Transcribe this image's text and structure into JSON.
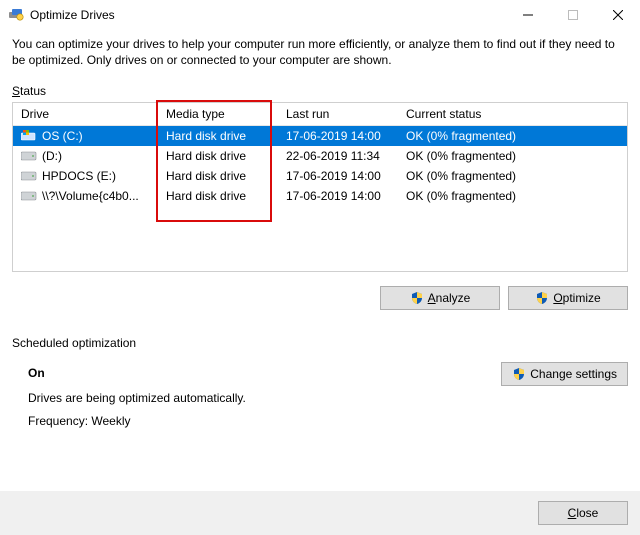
{
  "window": {
    "title": "Optimize Drives"
  },
  "description": "You can optimize your drives to help your computer run more efficiently, or analyze them to find out if they need to be optimized. Only drives on or connected to your computer are shown.",
  "labels": {
    "status_prefix": "S",
    "status_rest": "tatus"
  },
  "columns": {
    "drive": "Drive",
    "media": "Media type",
    "last": "Last run",
    "status": "Current status"
  },
  "drives": [
    {
      "name": "OS (C:)",
      "media": "Hard disk drive",
      "last": "17-06-2019 14:00",
      "status": "OK (0% fragmented)",
      "icon": "os",
      "selected": true
    },
    {
      "name": "(D:)",
      "media": "Hard disk drive",
      "last": "22-06-2019 11:34",
      "status": "OK (0% fragmented)",
      "icon": "hdd",
      "selected": false
    },
    {
      "name": "HPDOCS (E:)",
      "media": "Hard disk drive",
      "last": "17-06-2019 14:00",
      "status": "OK (0% fragmented)",
      "icon": "hdd",
      "selected": false
    },
    {
      "name": "\\\\?\\Volume{c4b0...",
      "media": "Hard disk drive",
      "last": "17-06-2019 14:00",
      "status": "OK (0% fragmented)",
      "icon": "hdd",
      "selected": false
    }
  ],
  "buttons": {
    "analyze_u": "A",
    "analyze_rest": "nalyze",
    "optimize_u": "O",
    "optimize_rest": "ptimize",
    "change_settings": "Change settings",
    "close_u": "C",
    "close_rest": "lose"
  },
  "scheduled": {
    "heading": "Scheduled optimization",
    "state": "On",
    "desc": "Drives are being optimized automatically.",
    "freq": "Frequency: Weekly"
  }
}
